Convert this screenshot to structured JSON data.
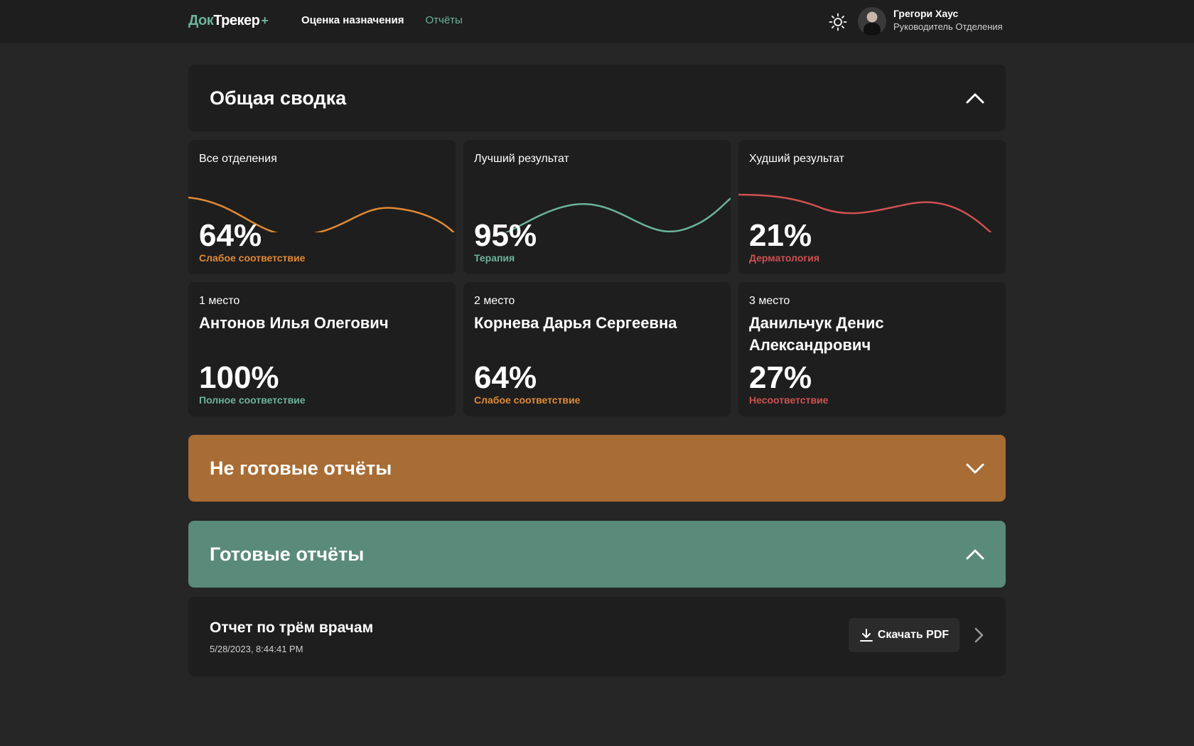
{
  "header": {
    "logo": {
      "part1": "Док",
      "part2": "Трекер",
      "part3": "+"
    },
    "nav": [
      {
        "label": "Оценка назначения"
      },
      {
        "label": "Отчёты"
      }
    ],
    "user": {
      "name": "Грегори Хаус",
      "role": "Руководитель Отделения"
    }
  },
  "summary": {
    "title": "Общая сводка",
    "stats": [
      {
        "label": "Все отделения",
        "value": "64%",
        "sub": "Слабое соответствие",
        "color": "#e08a35"
      },
      {
        "label": "Лучший результат",
        "value": "95%",
        "sub": "Терапия",
        "color": "#6cb39b"
      },
      {
        "label": "Худший результат",
        "value": "21%",
        "sub": "Дерматология",
        "color": "#d05050"
      }
    ],
    "doctors": [
      {
        "place": "1 место",
        "name": "Антонов Илья Олегович",
        "value": "100%",
        "sub": "Полное соответствие",
        "color": "#6cb39b"
      },
      {
        "place": "2 место",
        "name": "Корнева Дарья Сергеевна",
        "value": "64%",
        "sub": "Слабое соответствие",
        "color": "#e08a35"
      },
      {
        "place": "3 место",
        "name": "Данильчук Денис Александрович",
        "value": "27%",
        "sub": "Несоответствие",
        "color": "#d05050"
      }
    ]
  },
  "not_ready": {
    "title": "Не готовые отчёты"
  },
  "ready": {
    "title": "Готовые отчёты",
    "reports": [
      {
        "title": "Отчет по трём врачам",
        "date": "5/28/2023, 8:44:41 PM",
        "button": "Скачать PDF"
      }
    ]
  },
  "colors": {
    "accent_green": "#6cb39b",
    "accent_orange": "#e08a35",
    "accent_red": "#d05050",
    "panel_orange": "#a86c35",
    "panel_green": "#5a8a7a"
  }
}
